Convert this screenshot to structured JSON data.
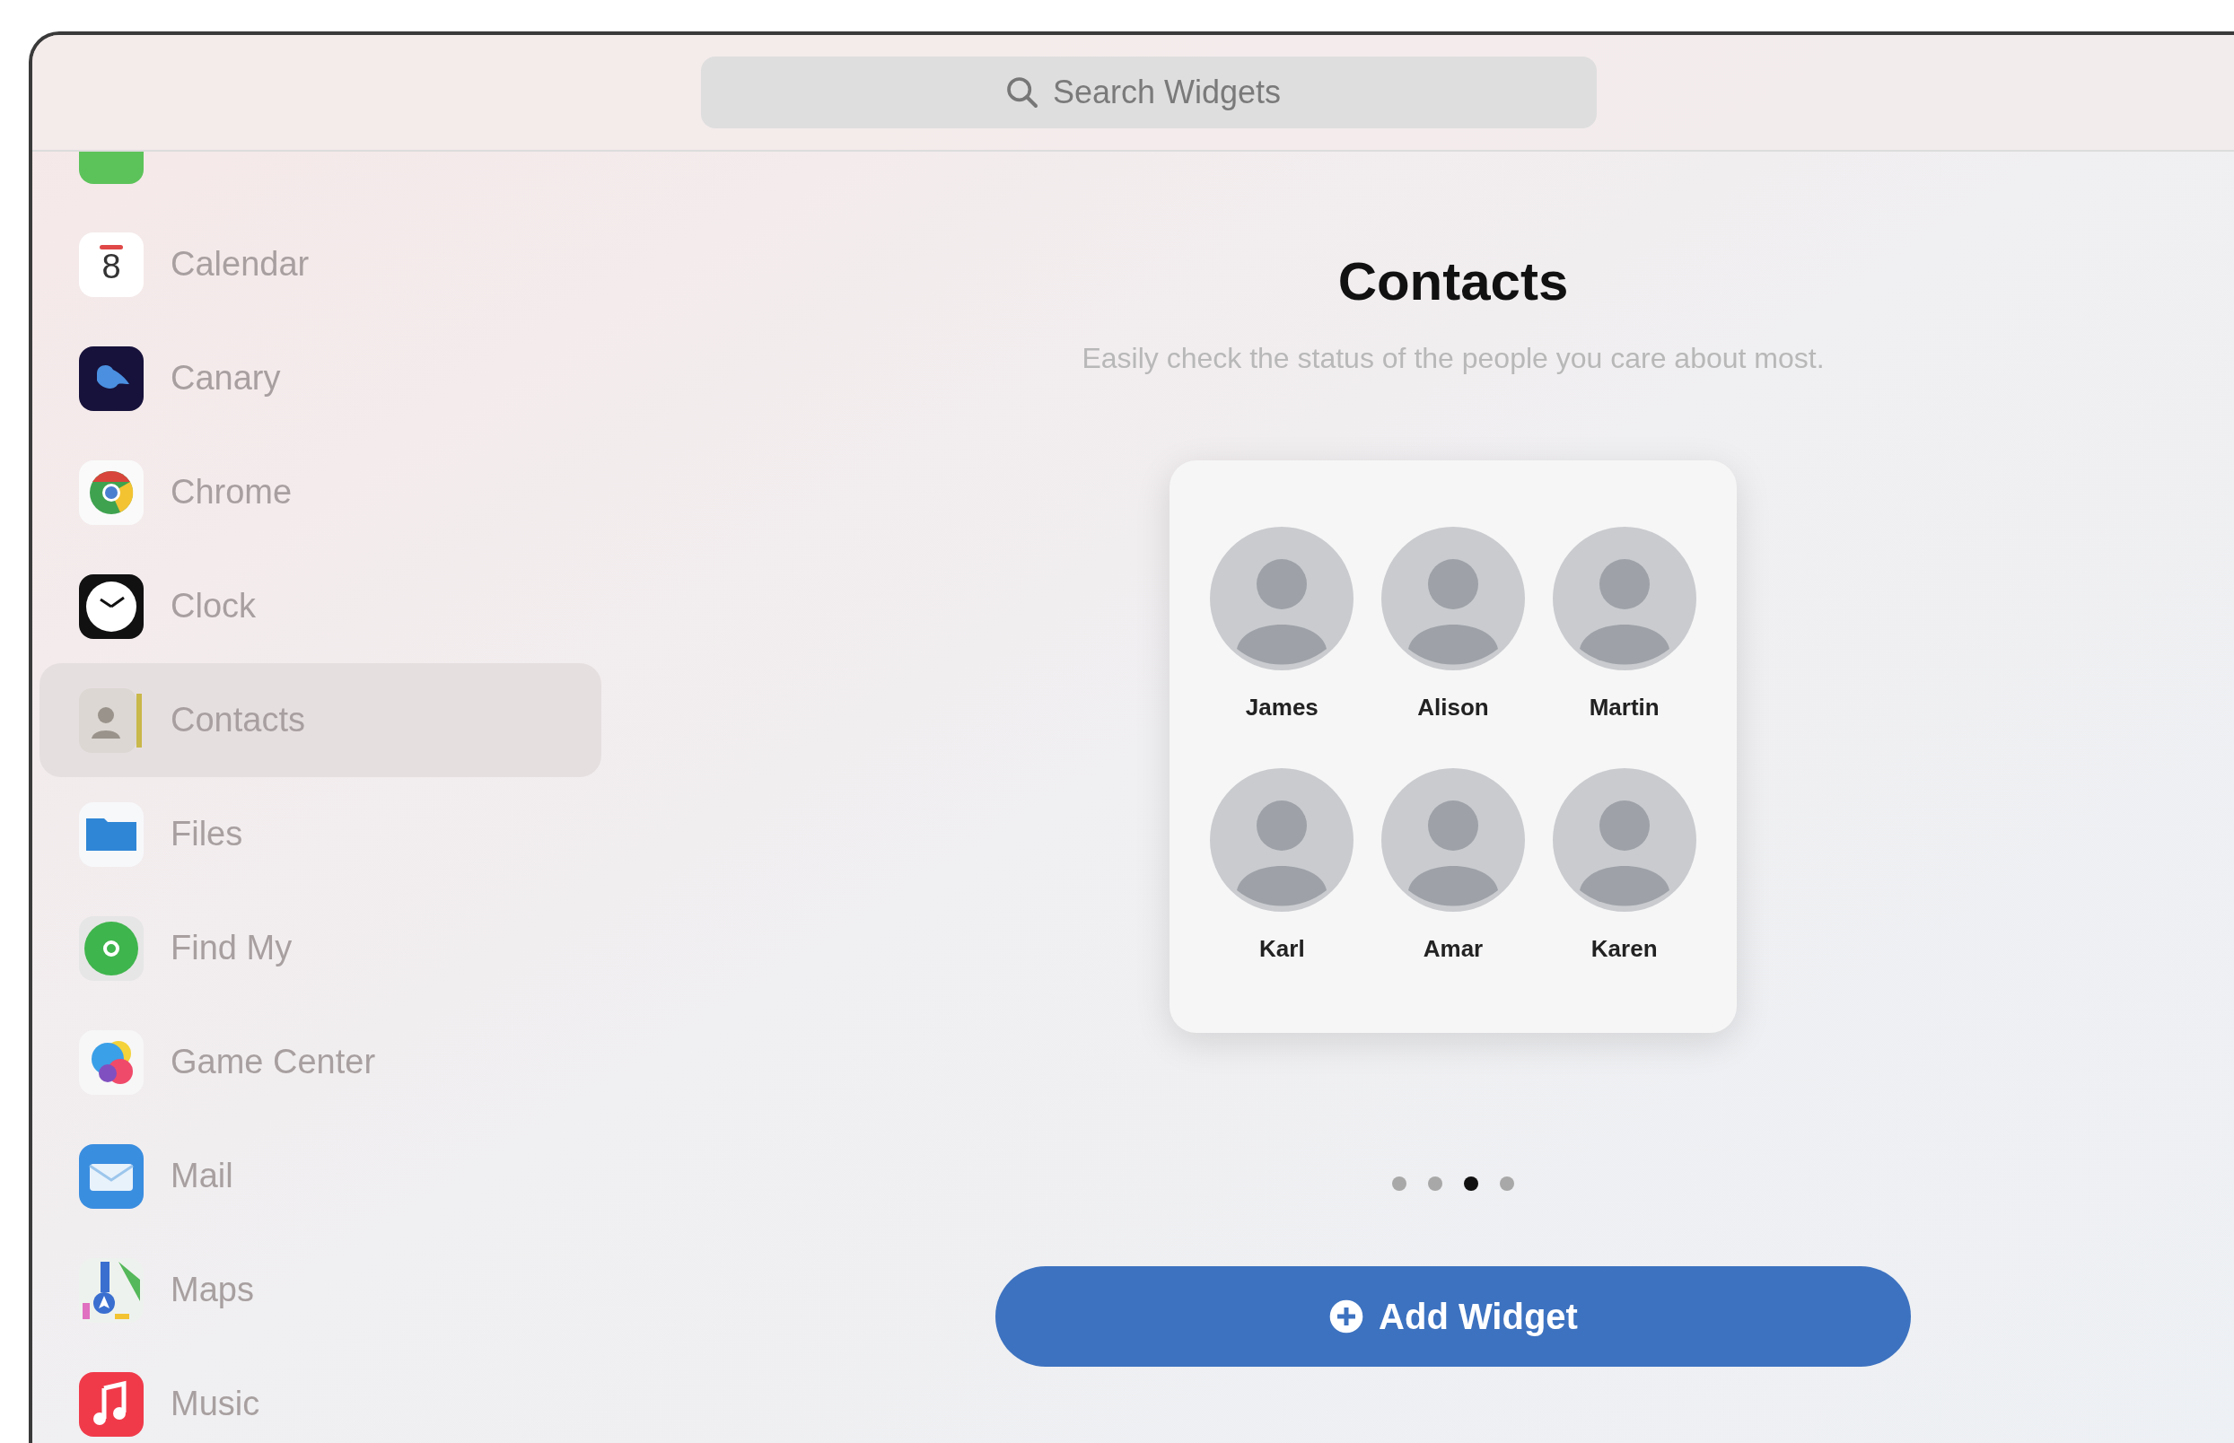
{
  "search": {
    "placeholder": "Search Widgets"
  },
  "sidebar": {
    "items": [
      {
        "kind": "calendar",
        "label": "Calendar",
        "selected": false,
        "icon_text": "8"
      },
      {
        "kind": "canary",
        "label": "Canary",
        "selected": false
      },
      {
        "kind": "chrome",
        "label": "Chrome",
        "selected": false
      },
      {
        "kind": "clock",
        "label": "Clock",
        "selected": false
      },
      {
        "kind": "contacts",
        "label": "Contacts",
        "selected": true
      },
      {
        "kind": "files",
        "label": "Files",
        "selected": false
      },
      {
        "kind": "findmy",
        "label": "Find My",
        "selected": false
      },
      {
        "kind": "gamecenter",
        "label": "Game Center",
        "selected": false
      },
      {
        "kind": "mail",
        "label": "Mail",
        "selected": false
      },
      {
        "kind": "maps",
        "label": "Maps",
        "selected": false
      },
      {
        "kind": "music",
        "label": "Music",
        "selected": false
      }
    ]
  },
  "detail": {
    "title": "Contacts",
    "subtitle": "Easily check the status of the people you care about most.",
    "contacts": [
      {
        "name": "James"
      },
      {
        "name": "Alison"
      },
      {
        "name": "Martin"
      },
      {
        "name": "Karl"
      },
      {
        "name": "Amar"
      },
      {
        "name": "Karen"
      }
    ],
    "page_dots": [
      {
        "selected": false
      },
      {
        "selected": false
      },
      {
        "selected": true
      },
      {
        "selected": false
      }
    ],
    "button": {
      "label": "Add Widget"
    }
  }
}
